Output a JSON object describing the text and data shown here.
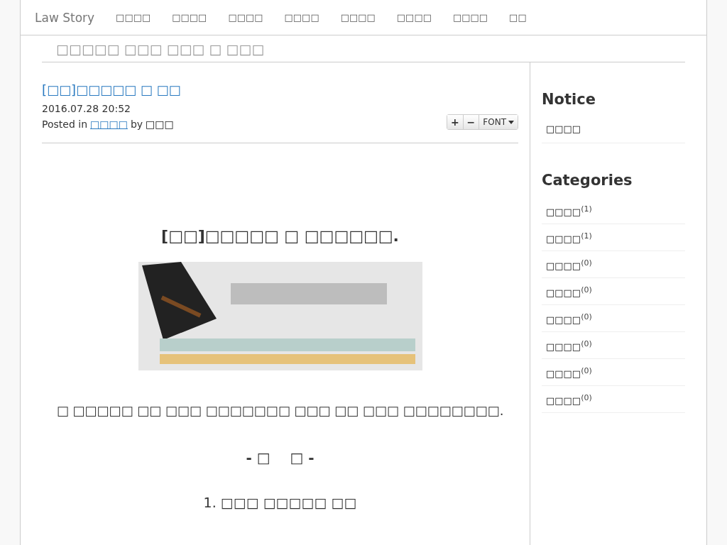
{
  "navbar": {
    "brand": "Law Story",
    "items": [
      "□□□□",
      "□□□□",
      "□□□□",
      "□□□□",
      "□□□□",
      "□□□□",
      "□□□□",
      "□□"
    ]
  },
  "subtitle": "□□□□□ □□□ □□□ □ □□□",
  "post": {
    "title": "[□□]□□□□□ □ □□",
    "date": "2016.07.28 20:52",
    "posted_in_label": "Posted in",
    "category": "□□□□",
    "by_label": "by",
    "author": "□□□",
    "font_controls": {
      "increase": "+",
      "decrease": "−",
      "font": "FONT"
    },
    "heading": "[□□]□□□□□ □ □□□□□□.",
    "paragraph": "□ □□□□□ □□ □□□ □□□□□□□ □□□ □□ □□□ □□□□□□□□.",
    "section_title": "- □    □ -",
    "list_item": "1. □□□ □□□□□ □□"
  },
  "sidebar": {
    "notice_title": "Notice",
    "notice_items": [
      "□□□□"
    ],
    "categories_title": "Categories",
    "categories": [
      {
        "name": "□□□□",
        "count": "(1)"
      },
      {
        "name": "□□□□",
        "count": "(1)"
      },
      {
        "name": "□□□□",
        "count": "(0)"
      },
      {
        "name": "□□□□",
        "count": "(0)"
      },
      {
        "name": "□□□□",
        "count": "(0)"
      },
      {
        "name": "□□□□",
        "count": "(0)"
      },
      {
        "name": "□□□□",
        "count": "(0)"
      },
      {
        "name": "□□□□",
        "count": "(0)"
      }
    ]
  }
}
